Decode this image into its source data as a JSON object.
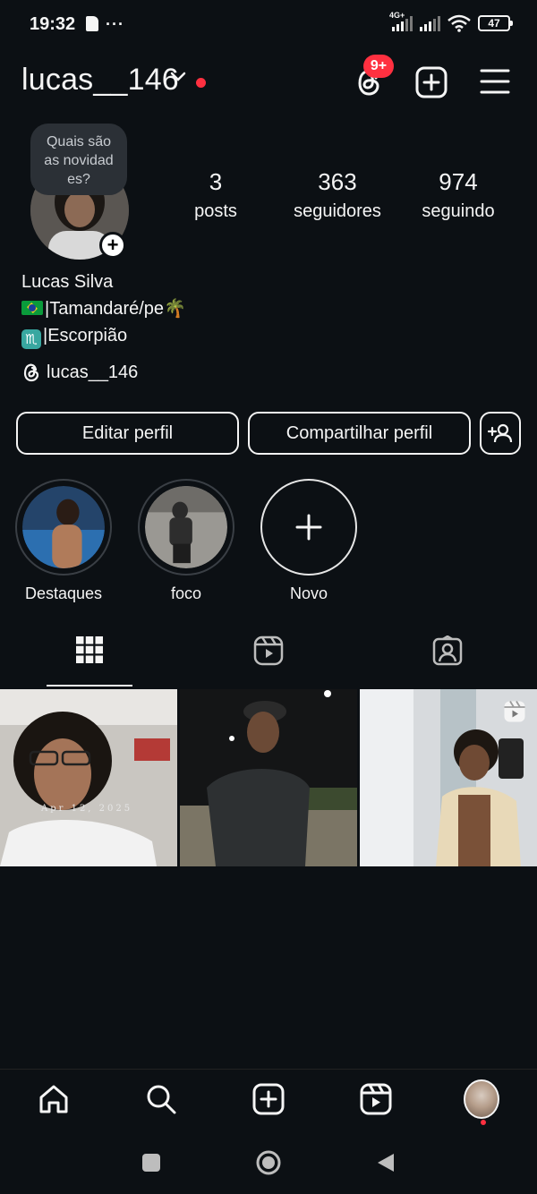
{
  "status_bar": {
    "time": "19:32",
    "network": "4G+",
    "battery": "47"
  },
  "header": {
    "username": "lucas__146",
    "notification_badge": "9+"
  },
  "profile": {
    "avatar_note": "Quais são as novidad es?",
    "stats": [
      {
        "value": "3",
        "label": "posts"
      },
      {
        "value": "363",
        "label": "seguidores"
      },
      {
        "value": "974",
        "label": "seguindo"
      }
    ],
    "full_name": "Lucas Silva",
    "bio_line1": "|Tamandaré/pe🌴",
    "bio_line2": "|Escorpião",
    "threads_handle": "lucas__146"
  },
  "actions": {
    "edit_profile": "Editar perfil",
    "share_profile": "Compartilhar perfil"
  },
  "highlights": [
    {
      "label": "Destaques"
    },
    {
      "label": "foco"
    },
    {
      "label": "Novo"
    }
  ],
  "tabs": [
    "posts-grid",
    "reels",
    "tagged"
  ],
  "grid": [
    {
      "type": "photo",
      "caption": "Apr 12, 2025"
    },
    {
      "type": "photo"
    },
    {
      "type": "reel"
    }
  ],
  "colors": {
    "background": "#0c1014",
    "accent_red": "#ff3040",
    "text": "#f5f5f5"
  }
}
